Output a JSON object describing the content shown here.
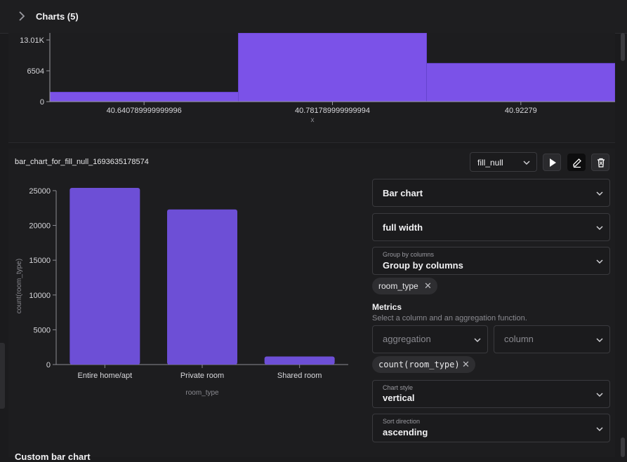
{
  "header": {
    "title": "Charts (5)"
  },
  "histogram": {
    "y_ticks": [
      "13.01K",
      "6504",
      "0"
    ],
    "x_ticks": [
      "40.640789999999996",
      "40.781789999999994",
      "40.92279"
    ],
    "x_label": "x",
    "bar_color": "#7b52e8"
  },
  "chart_card": {
    "name": "bar_chart_for_fill_null_1693635178574",
    "dataset_select": "fill_null",
    "run_icon": "play-icon",
    "edit_icon": "pencil-icon",
    "delete_icon": "trash-icon"
  },
  "config": {
    "chart_type": "Bar chart",
    "width": "full width",
    "group_by": {
      "label": "Group by columns",
      "value": "Group by columns",
      "chip": "room_type"
    },
    "metrics": {
      "title": "Metrics",
      "description": "Select a column and an aggregation function.",
      "aggregation_placeholder": "aggregation",
      "column_placeholder": "column",
      "chip": "count(room_type)"
    },
    "chart_style": {
      "label": "Chart style",
      "value": "vertical"
    },
    "sort_direction": {
      "label": "Sort direction",
      "value": "ascending"
    }
  },
  "chart_data": [
    {
      "type": "bar",
      "categories": [
        "40.640789999999996",
        "40.781789999999994",
        "40.92279"
      ],
      "values": [
        2020,
        16300,
        8110
      ],
      "xlabel": "x",
      "ylabel": "",
      "ylim": [
        0,
        13010
      ],
      "yticks": [
        0,
        6504,
        13010
      ]
    },
    {
      "type": "bar",
      "categories": [
        "Entire home/apt",
        "Private room",
        "Shared room"
      ],
      "values": [
        25400,
        22300,
        1160
      ],
      "xlabel": "room_type",
      "ylabel": "count(room_type)",
      "ylim": [
        0,
        26000
      ],
      "yticks": [
        0,
        5000,
        10000,
        15000,
        20000,
        25000
      ],
      "bar_color": "#6d4fd6"
    }
  ],
  "footer": {
    "next_card_title": "Custom bar chart"
  }
}
